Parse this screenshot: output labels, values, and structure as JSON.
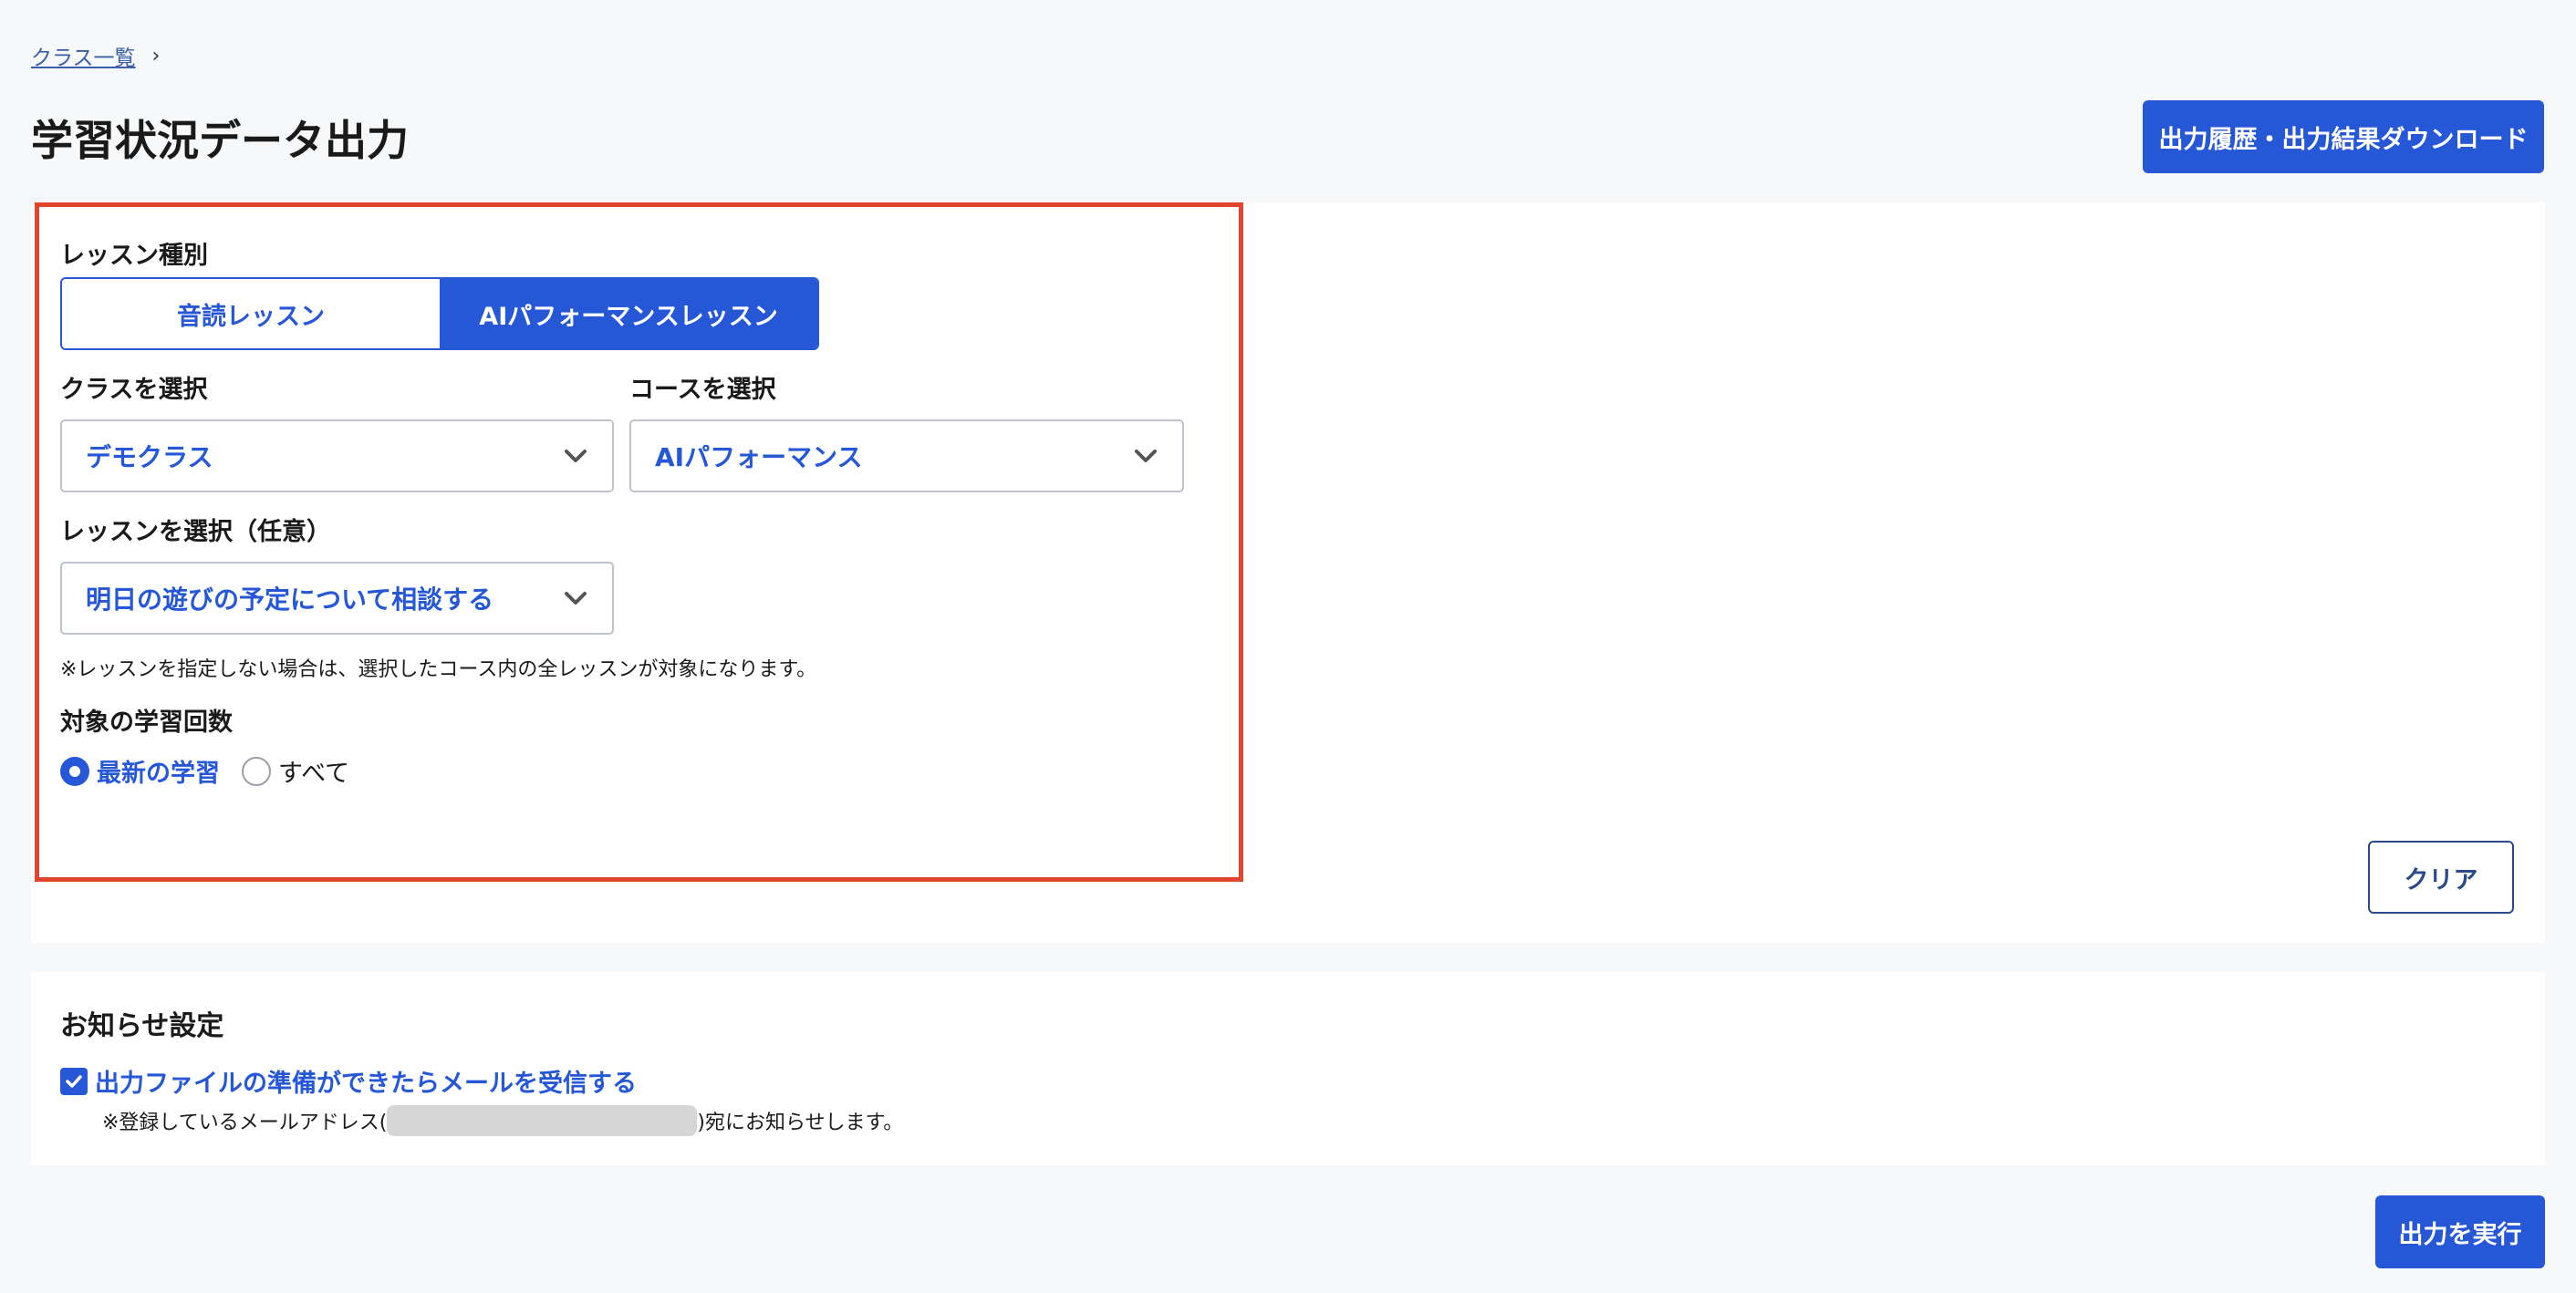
{
  "breadcrumb": {
    "link": "クラス一覧",
    "separator": "›"
  },
  "page_title": "学習状況データ出力",
  "history_button": "出力履歴・出力結果ダウンロード",
  "lesson_type": {
    "label": "レッスン種別",
    "options": [
      "音読レッスン",
      "AIパフォーマンスレッスン"
    ],
    "selected": "AIパフォーマンスレッスン"
  },
  "class_select": {
    "label": "クラスを選択",
    "value": "デモクラス"
  },
  "course_select": {
    "label": "コースを選択",
    "value": "AIパフォーマンス"
  },
  "lesson_select": {
    "label": "レッスンを選択（任意）",
    "value": "明日の遊びの予定について相談する"
  },
  "lesson_note": "※レッスンを指定しない場合は、選択したコース内の全レッスンが対象になります。",
  "study_count": {
    "label": "対象の学習回数",
    "options": [
      "最新の学習",
      "すべて"
    ],
    "selected": "最新の学習"
  },
  "clear_button": "クリア",
  "notification": {
    "title": "お知らせ設定",
    "checkbox_label": "出力ファイルの準備ができたらメールを受信する",
    "checked": true,
    "note_prefix": "※登録しているメールアドレス(",
    "note_suffix": ")宛にお知らせします。"
  },
  "run_button": "出力を実行",
  "colors": {
    "accent": "#2557d6",
    "highlight": "#e0452e",
    "background": "#f7f8fa"
  }
}
